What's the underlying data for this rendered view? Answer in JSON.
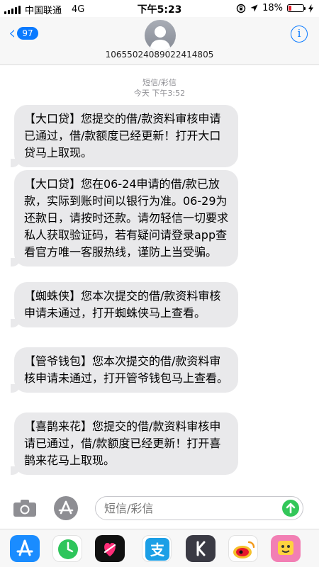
{
  "status_bar": {
    "carrier": "中国联通",
    "network": "4G",
    "time": "下午5:23",
    "battery": "18%",
    "battery_level": 0.18,
    "icons": [
      "signal-icon",
      "lock-rotation-icon",
      "location-icon",
      "battery-icon",
      "charging-icon"
    ]
  },
  "header": {
    "back_count": "97",
    "contact_number": "10655024089022414805",
    "icons": [
      "back-chevron-icon",
      "avatar-icon",
      "info-icon"
    ]
  },
  "thread": {
    "service": "短信/彩信",
    "timestamp": "今天 下午3:52",
    "messages": [
      {
        "text": "【大口贷】您提交的借/款资料审核申请已通过，借/款额度已经更新！打开大口贷马上取现。"
      },
      {
        "text": "【大口贷】您在06-24申请的借/款已放款，实际到账时间以银行为准。06-29为还款日，请按时还款。请勿轻信一切要求私人获取验证码，若有疑问请登录app查看官方唯一客服热线，谨防上当受骗。"
      },
      {
        "text": "【蜘蛛侠】您本次提交的借/款资料审核申请未通过，打开蜘蛛侠马上查看。"
      },
      {
        "text": "【管爷钱包】您本次提交的借/款资料审核申请未通过，打开管爷钱包马上查看。"
      },
      {
        "text": "【喜鹊来花】您提交的借/款资料审核申请已通过，借/款额度已经更新！打开喜鹊来花马上取现。"
      }
    ]
  },
  "input_bar": {
    "placeholder": "短信/彩信",
    "icons": [
      "camera-icon",
      "app-store-icon",
      "send-arrow-icon"
    ]
  },
  "app_drawer": {
    "apps": [
      "app-store-icon",
      "clock-icon",
      "digital-touch-icon",
      "alipay-icon",
      "k-app-icon",
      "weibo-icon",
      "sticker-app-icon"
    ]
  },
  "colors": {
    "accent": "#0a7aff",
    "bubble": "#e9e9eb",
    "send": "#33c759",
    "meta_text": "#8e8e93"
  }
}
